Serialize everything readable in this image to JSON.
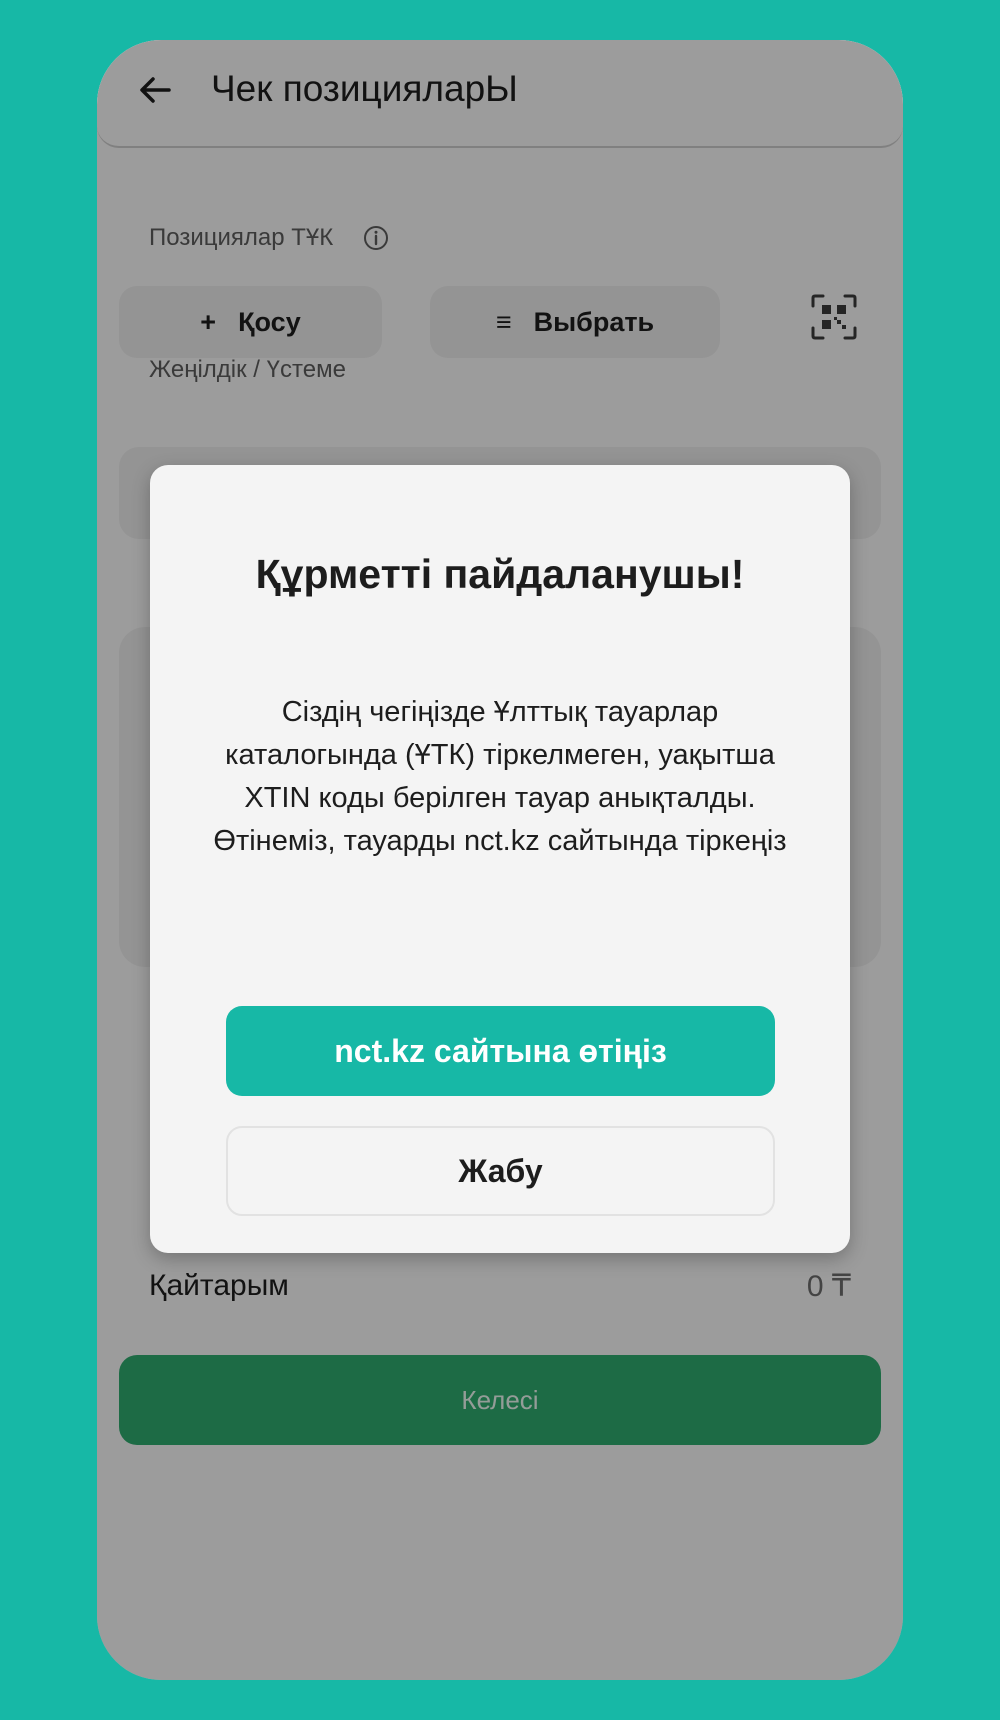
{
  "app_bar": {
    "title": "Чек позицияларЫ",
    "back_icon": "arrow-back-icon"
  },
  "positions": {
    "label": "Позициялар ТҰК",
    "info_icon": "info-icon",
    "add_label": "Қосу",
    "add_glyph": "+",
    "select_label": "Выбрать",
    "select_glyph": "≡",
    "qr_icon": "qr-scan-icon"
  },
  "discount": {
    "label": "Жеңілдік / Үстеме"
  },
  "change": {
    "label": "Қайтарым",
    "value": "0 ₸"
  },
  "next_button": {
    "label": "Келесі"
  },
  "dialog": {
    "title": "Құрметті пайдаланушы!",
    "message": "Сіздің чегіңізде Ұлттық тауарлар каталогында (ҰТК) тіркелмеген, уақытша XTIN коды берілген тауар анықталды. Өтінеміз, тауарды nct.kz сайтында тіркеңіз",
    "primary_button": "nct.kz сайтына өтіңіз",
    "secondary_button": "Жабу"
  },
  "colors": {
    "background": "#17b8a6",
    "accent": "#17b8a6",
    "next_button": "#2ea86c"
  }
}
